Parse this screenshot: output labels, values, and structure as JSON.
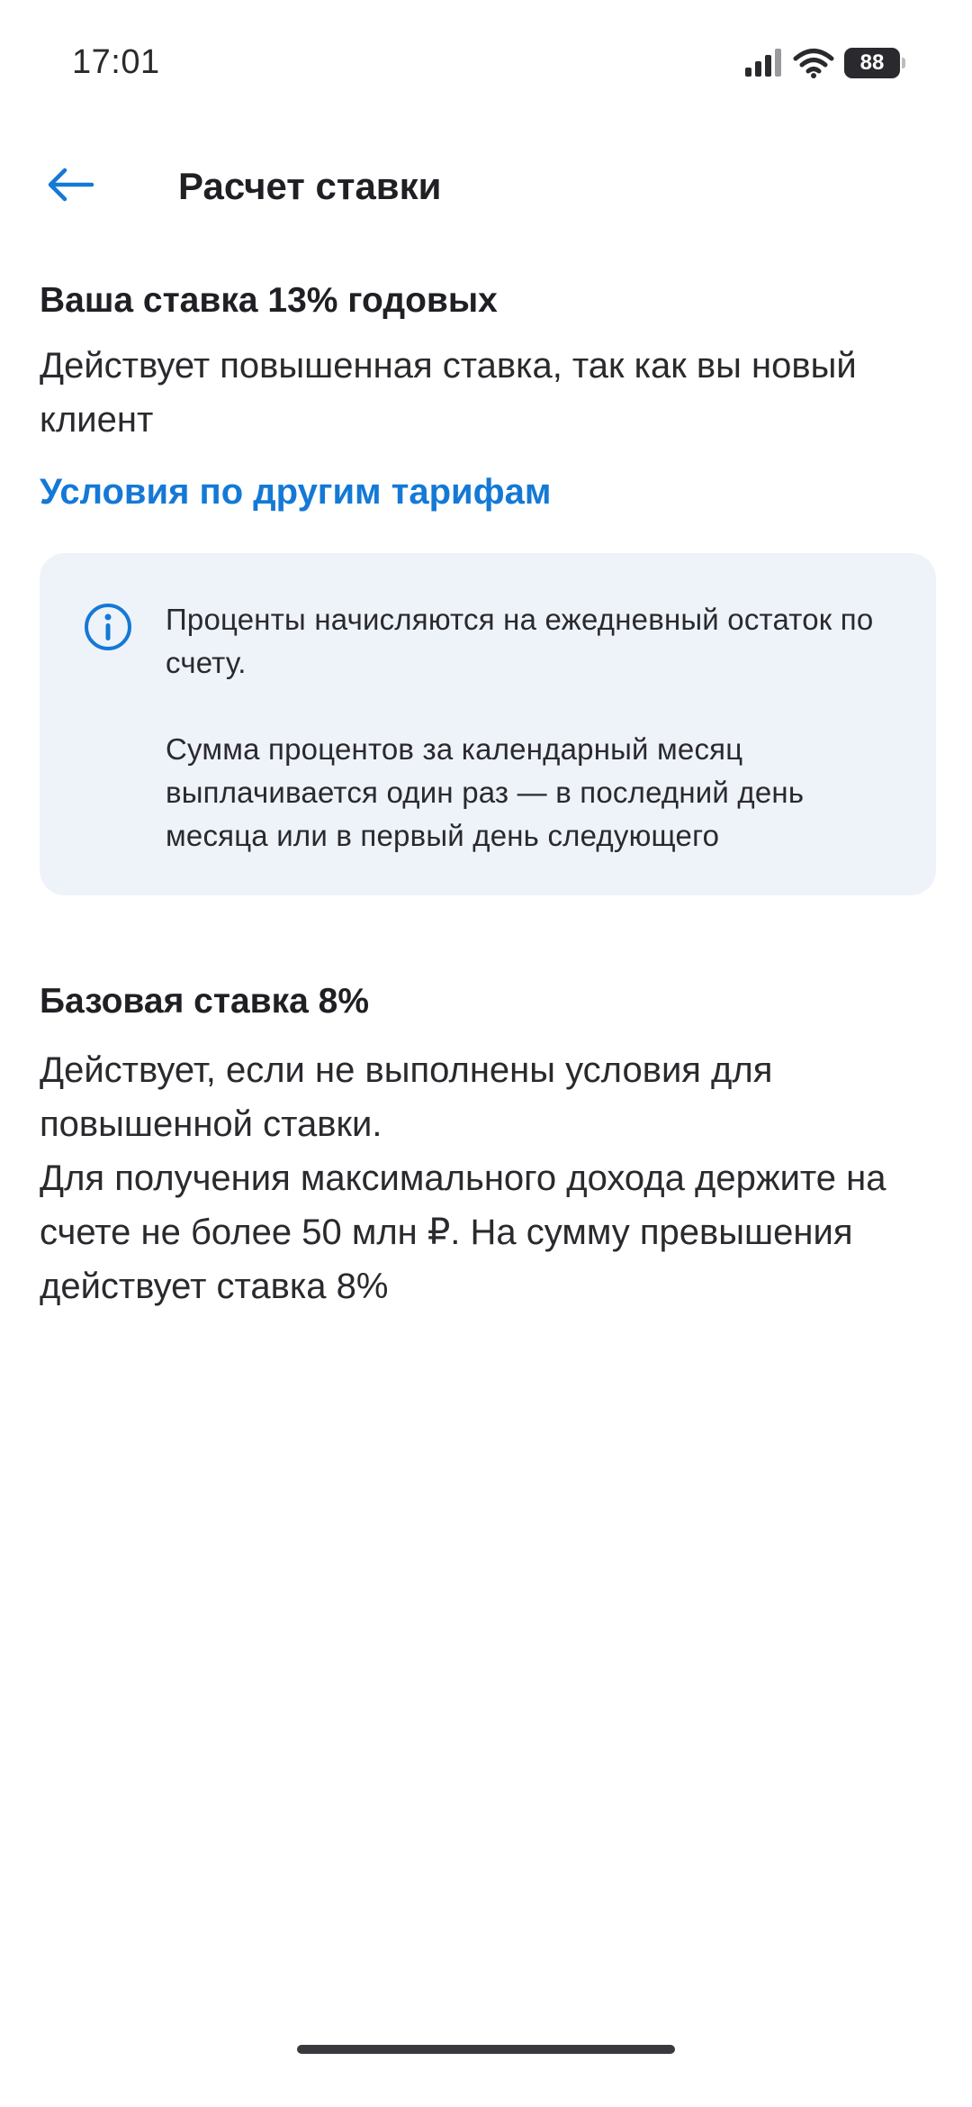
{
  "status_bar": {
    "time": "17:01",
    "battery": "88"
  },
  "header": {
    "title": "Расчет ставки"
  },
  "rate": {
    "title": "Ваша ставка 13% годовых",
    "description": "Действует повышенная ставка, так как вы новый клиент",
    "link": "Условия по другим тарифам"
  },
  "info_card": {
    "paragraph1": "Проценты начисляются на ежедневный остаток по счету.",
    "paragraph2": "Сумма процентов за календарный месяц выплачивается один раз — в последний день месяца или в первый день следующего"
  },
  "base_rate": {
    "title": "Базовая ставка 8%",
    "line1": "Действует, если не выполнены условия для повышенной ставки.",
    "line2": "Для получения максимального дохода держите на счете не более 50 млн ₽. На сумму превышения действует ставка 8%"
  },
  "icons": {
    "back": "arrow-left-icon",
    "info": "info-circle-icon",
    "signal": "signal-icon",
    "wifi": "wifi-icon"
  },
  "colors": {
    "accent": "#1479d6",
    "card_background": "#eef3fa",
    "text": "#1f1f24"
  }
}
